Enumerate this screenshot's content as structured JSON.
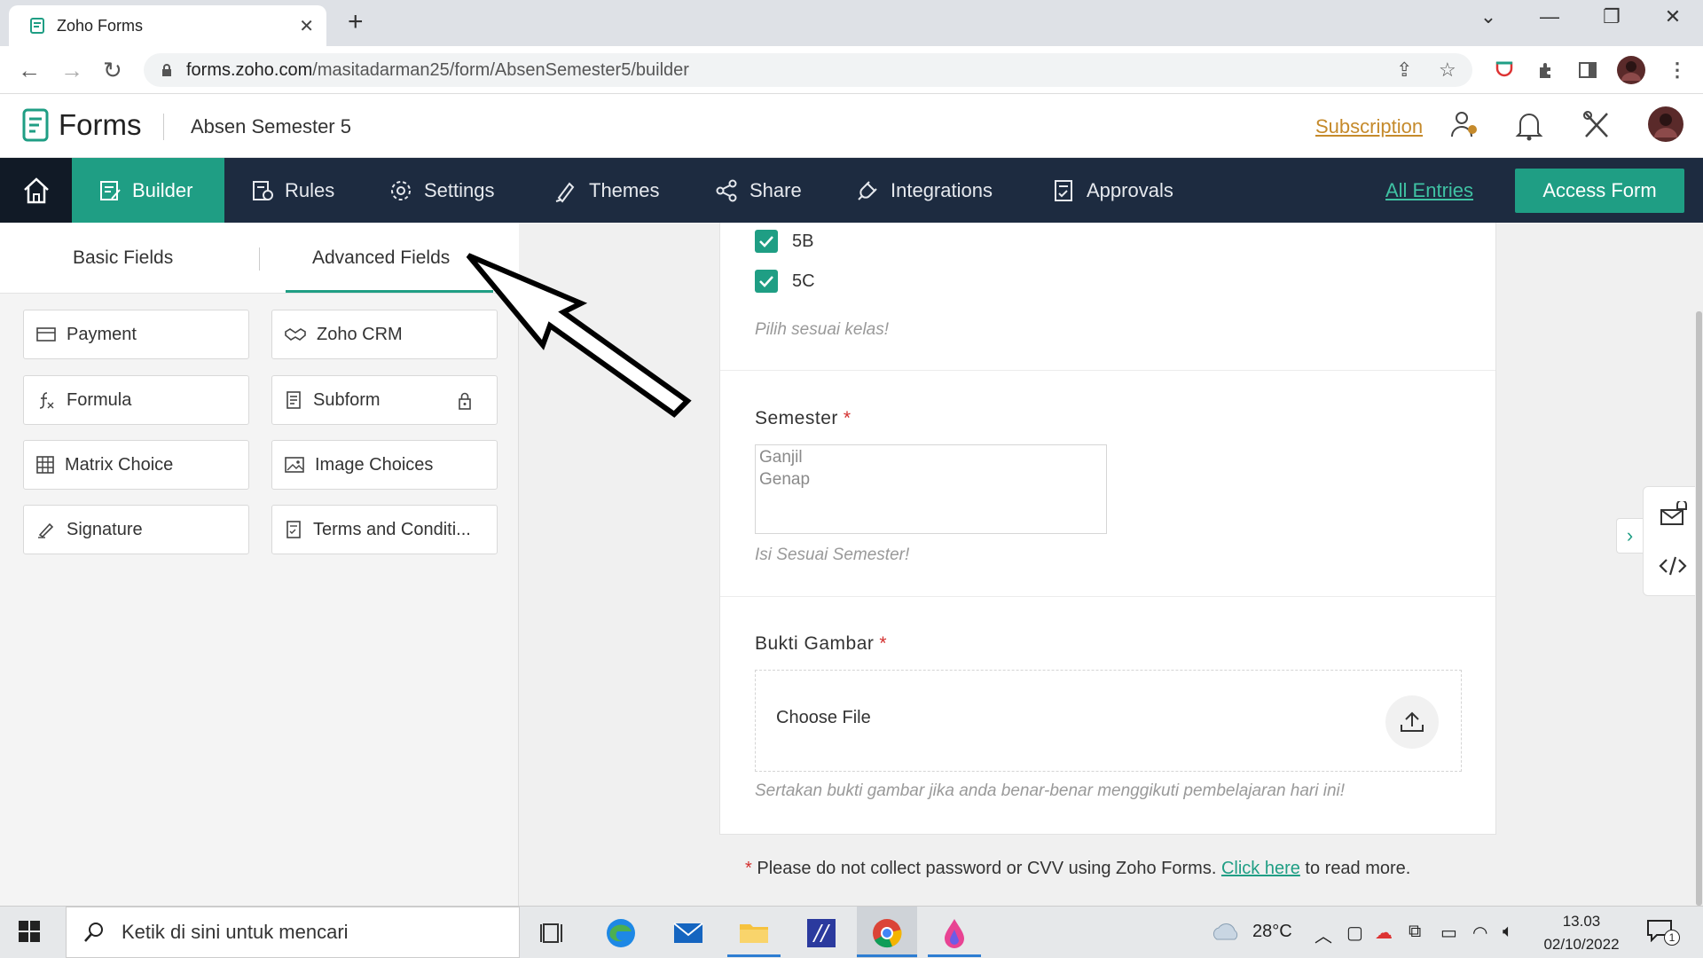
{
  "browser": {
    "tab_title": "Zoho Forms",
    "url_host": "forms.zoho.com",
    "url_path": "/masitadarman25/form/AbsenSemester5/builder"
  },
  "header": {
    "brand": "Forms",
    "form_name": "Absen Semester 5",
    "subscription": "Subscription"
  },
  "nav": {
    "items": [
      {
        "label": "Builder"
      },
      {
        "label": "Rules"
      },
      {
        "label": "Settings"
      },
      {
        "label": "Themes"
      },
      {
        "label": "Share"
      },
      {
        "label": "Integrations"
      },
      {
        "label": "Approvals"
      }
    ],
    "all_entries": "All Entries",
    "access_form": "Access Form"
  },
  "panel": {
    "tabs": [
      "Basic Fields",
      "Advanced Fields"
    ],
    "fields": [
      {
        "label": "Payment",
        "icon": "card-icon"
      },
      {
        "label": "Zoho CRM",
        "icon": "handshake-icon"
      },
      {
        "label": "Formula",
        "icon": "formula-icon"
      },
      {
        "label": "Subform",
        "icon": "subform-icon",
        "locked": true
      },
      {
        "label": "Matrix Choice",
        "icon": "grid-icon"
      },
      {
        "label": "Image Choices",
        "icon": "image-icon"
      },
      {
        "label": "Signature",
        "icon": "pen-icon"
      },
      {
        "label": "Terms and Conditi...",
        "icon": "document-icon"
      }
    ]
  },
  "form": {
    "checkboxes": [
      "5B",
      "5C"
    ],
    "class_hint": "Pilih sesuai kelas!",
    "semester": {
      "label": "Semester",
      "required_mark": "*",
      "options": [
        "Ganjil",
        "Genap"
      ],
      "hint": "Isi Sesuai Semester!"
    },
    "bukti": {
      "label": "Bukti Gambar",
      "required_mark": "*",
      "choose": "Choose File",
      "hint": "Sertakan bukti gambar jika anda benar-benar menggikuti pembelajaran hari ini!"
    },
    "notice": {
      "star": "*",
      "text": " Please do not collect password or CVV using Zoho Forms. ",
      "link": "Click here",
      "after": " to read more."
    }
  },
  "taskbar": {
    "search": "Ketik di sini untuk mencari",
    "temp": "28°C",
    "time": "13.03",
    "date": "02/10/2022",
    "notification_count": "1"
  },
  "colors": {
    "accent": "#1f9e84",
    "nav_bg": "#1d2b40",
    "required": "#d3302f",
    "subscription": "#c58a2b"
  }
}
